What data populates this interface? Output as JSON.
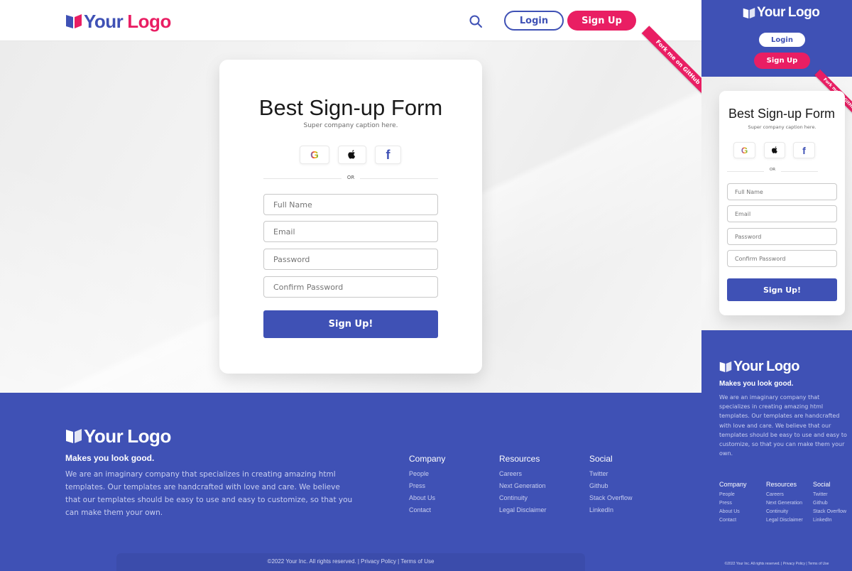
{
  "brand": {
    "logo_word1": "Your",
    "logo_word2": "Logo",
    "primary_color": "#3f51b5",
    "accent_color": "#e91e63"
  },
  "nav": {
    "search_icon": "search-icon",
    "login_label": "Login",
    "signup_label": "Sign Up"
  },
  "ribbon": {
    "label": "Fork me on GitHub"
  },
  "form": {
    "title": "Best Sign-up Form",
    "caption": "Super company caption here.",
    "social": [
      {
        "icon": "google-icon"
      },
      {
        "icon": "apple-icon"
      },
      {
        "icon": "facebook-icon"
      }
    ],
    "divider_label": "OR",
    "fields": {
      "full_name": {
        "placeholder": "Full Name",
        "value": ""
      },
      "email": {
        "placeholder": "Email",
        "value": ""
      },
      "password": {
        "placeholder": "Password",
        "value": ""
      },
      "confirm_password": {
        "placeholder": "Confirm Password",
        "value": ""
      }
    },
    "submit_label": "Sign Up!"
  },
  "footer": {
    "tagline": "Makes you look good.",
    "description": "We are an imaginary company that specializes in creating amazing html templates. Our templates are handcrafted with love and care. We believe that our templates should be easy to use and easy to customize, so that you can make them your own.",
    "columns": [
      {
        "title": "Company",
        "links": [
          "People",
          "Press",
          "About Us",
          "Contact"
        ]
      },
      {
        "title": "Resources",
        "links": [
          "Careers",
          "Next Generation",
          "Continuity",
          "Legal Disclaimer"
        ]
      },
      {
        "title": "Social",
        "links": [
          "Twitter",
          "Github",
          "Stack Overflow",
          "LinkedIn"
        ]
      }
    ],
    "copyright": "©2022 Your Inc. All rights reserved. | Privacy Policy | Terms of Use"
  }
}
